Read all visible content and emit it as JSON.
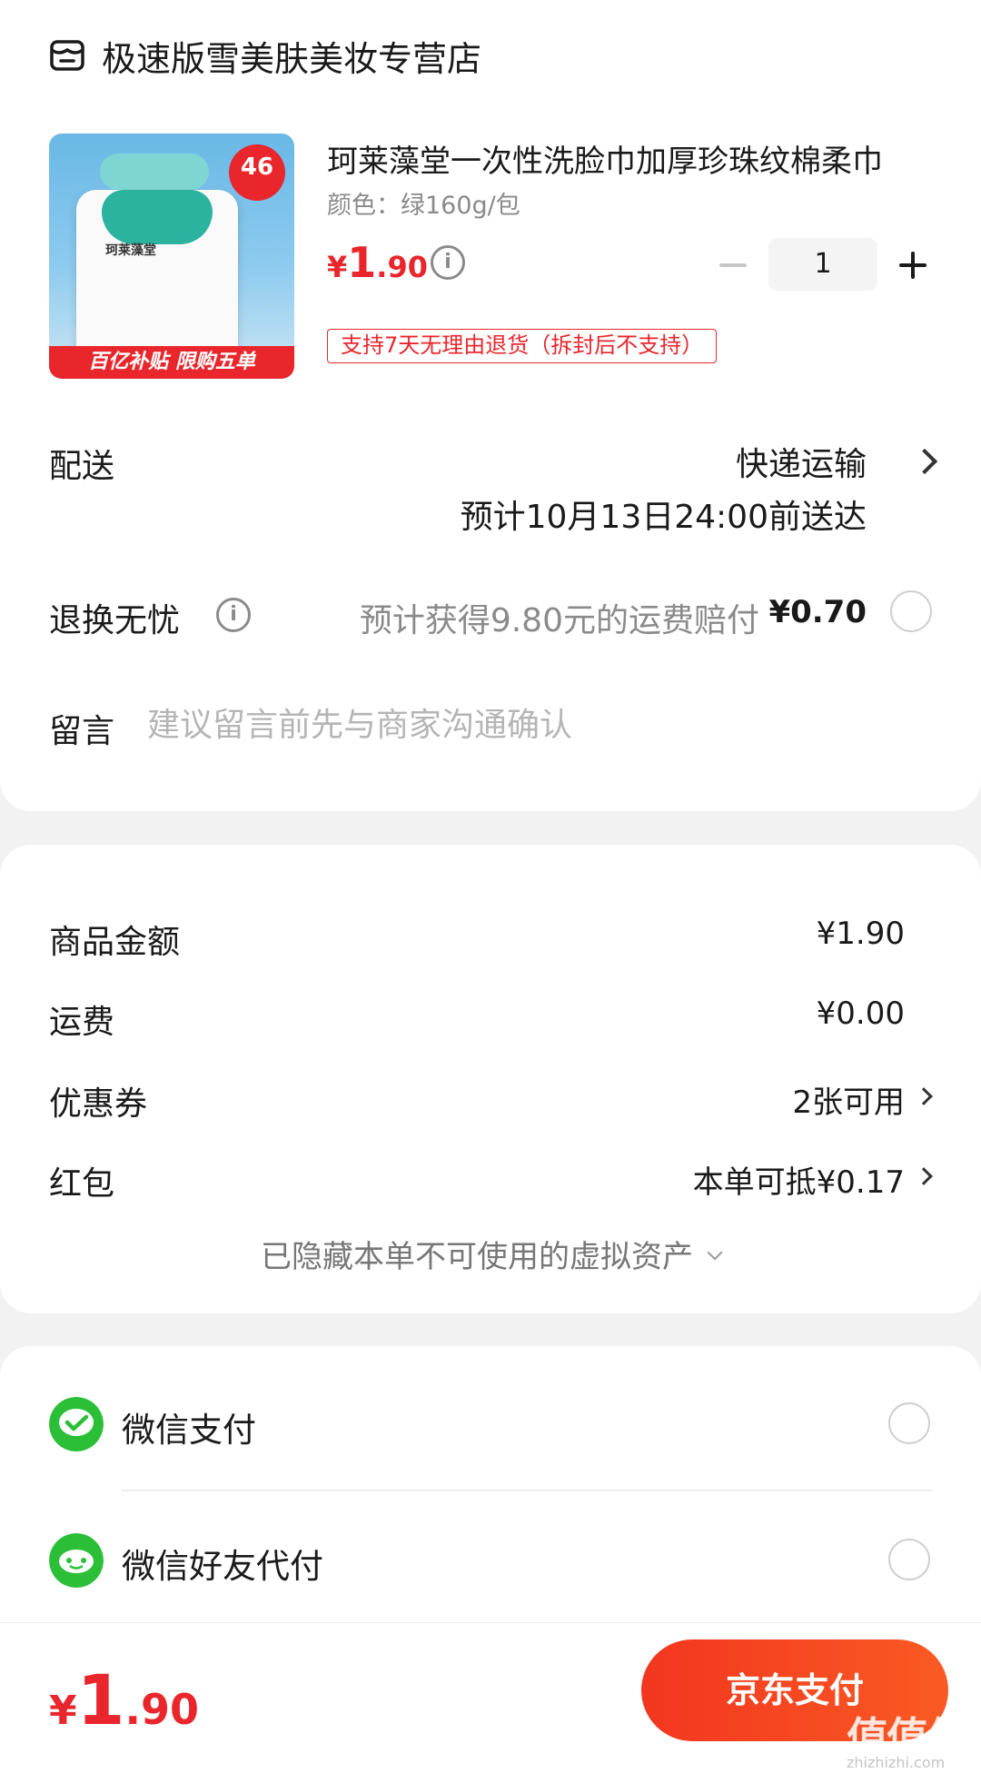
{
  "store": {
    "name": "极速版雪美肤美妆专营店",
    "icon": "store-icon"
  },
  "product": {
    "title": "珂莱藻堂一次性洗脸巾加厚珍珠纹棉柔巾",
    "spec": "颜色：绿160g/包",
    "price_symbol": "¥",
    "price_int": "1",
    "price_dec": ".90",
    "quantity": "1",
    "return_policy": "支持7天无理由退货（拆封后不支持）",
    "image": {
      "brand": "珂莱藻堂",
      "badge": "46",
      "banner": "百亿补贴 限购五单"
    }
  },
  "shipping": {
    "label": "配送",
    "method": "快递运输",
    "eta": "预计10月13日24:00前送达"
  },
  "worry_free": {
    "label": "退换无忧",
    "text": "预计获得9.80元的运费赔付",
    "price": "¥0.70"
  },
  "message": {
    "label": "留言",
    "placeholder": "建议留言前先与商家沟通确认"
  },
  "summary": {
    "goods_label": "商品金额",
    "goods_value": "¥1.90",
    "freight_label": "运费",
    "freight_value": "¥0.00",
    "coupon_label": "优惠券",
    "coupon_value": "2张可用",
    "redpacket_label": "红包",
    "redpacket_value": "本单可抵¥0.17",
    "hidden_assets": "已隐藏本单不可使用的虚拟资产"
  },
  "payment": {
    "wechat": "微信支付",
    "wechat_friend": "微信好友代付"
  },
  "bottom": {
    "total_symbol": "¥",
    "total_int": "1",
    "total_dec": ".90",
    "pay_button": "京东支付",
    "watermark": "值值值",
    "watermark_url": "zhizhizhi.com"
  },
  "colors": {
    "accent": "#e8262c",
    "pay_button": "#f2361f",
    "wechat_green": "#2bbf38"
  }
}
